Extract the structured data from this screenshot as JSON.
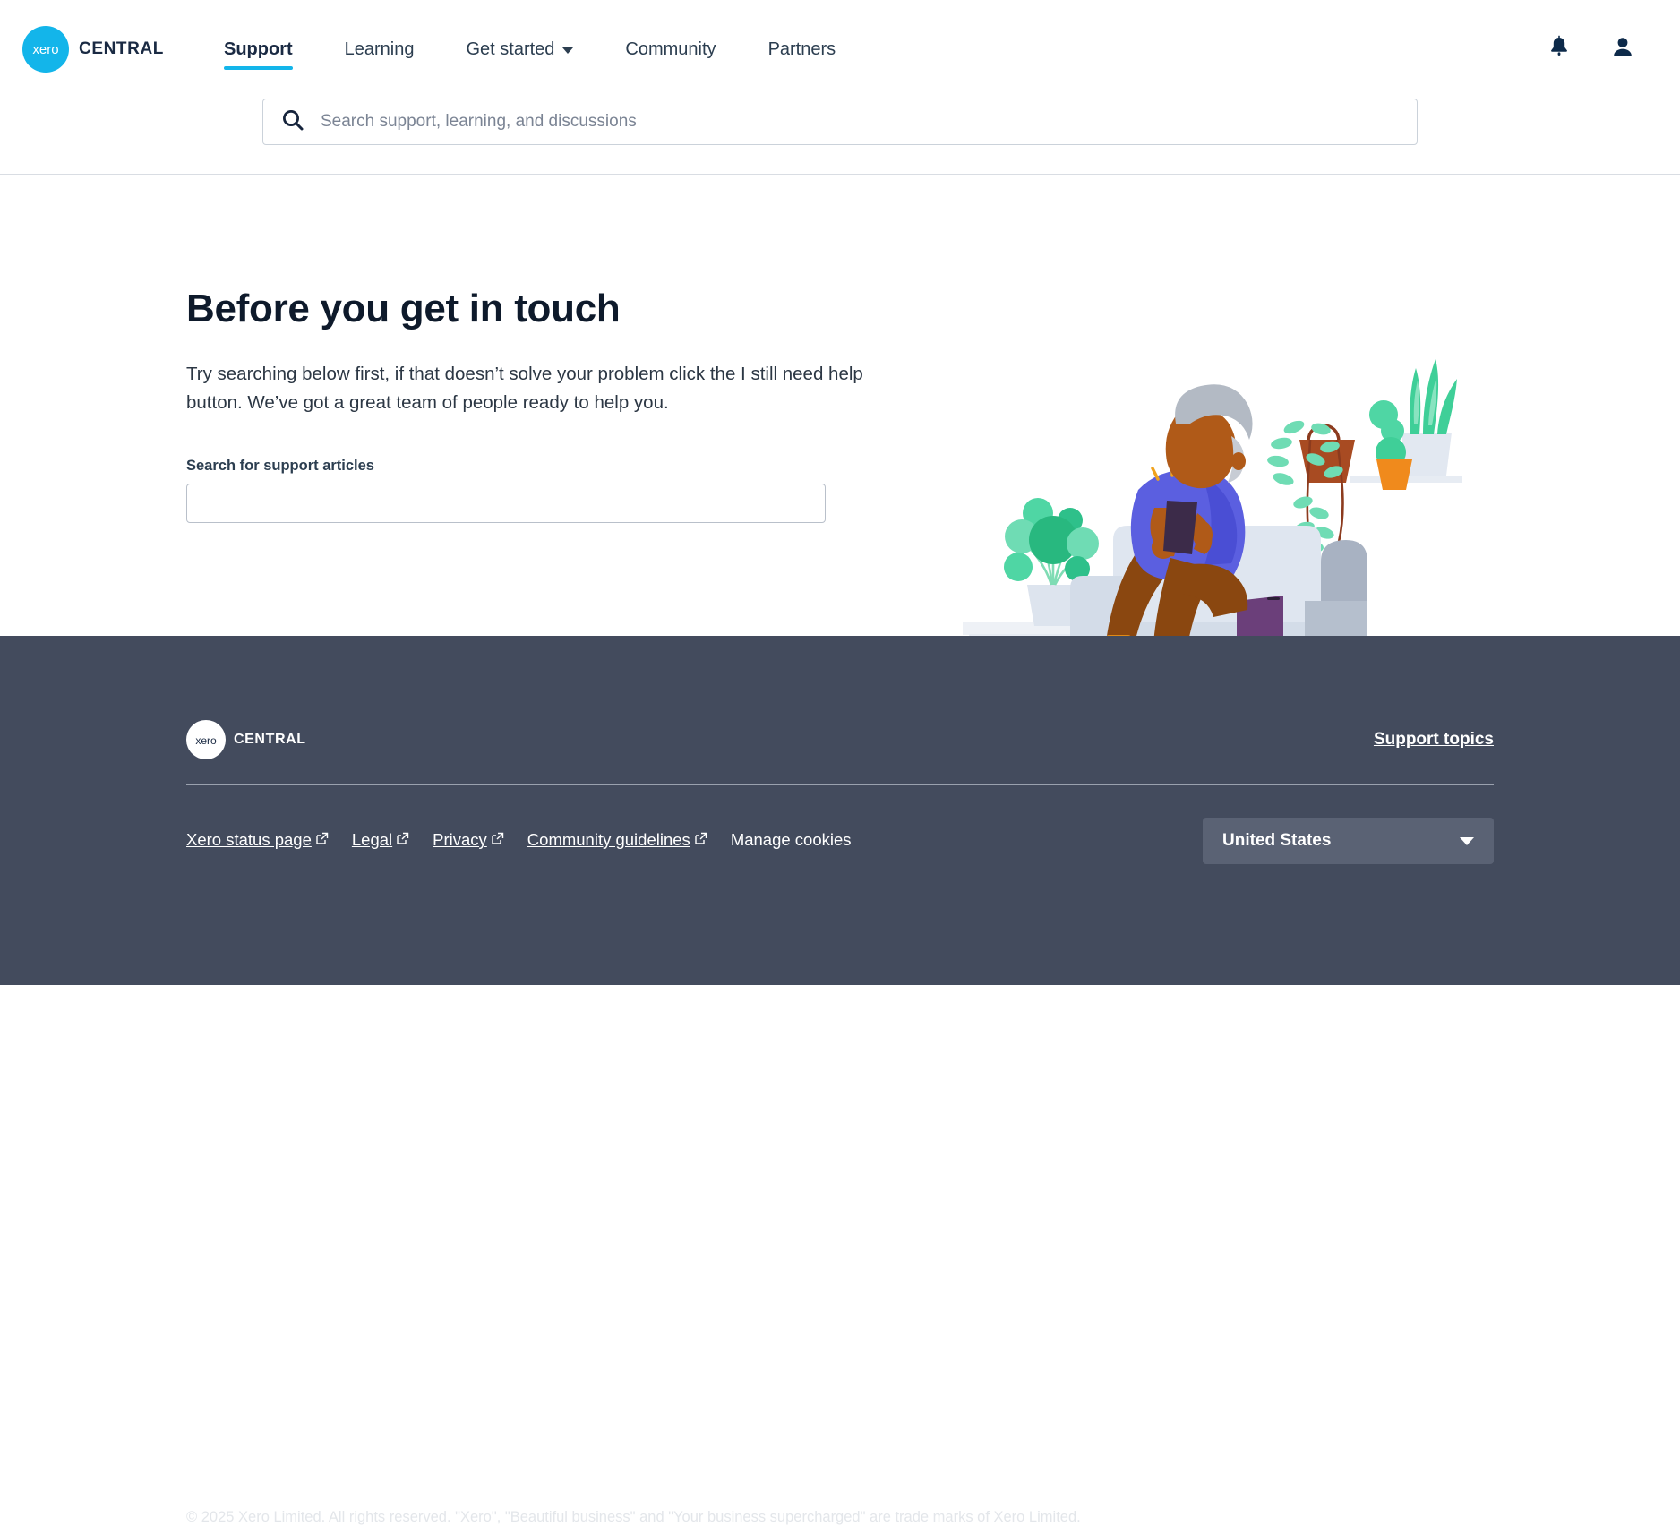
{
  "brand": {
    "mark_text": "xero",
    "word": "CENTRAL"
  },
  "nav": {
    "items": [
      {
        "label": "Support",
        "active": true,
        "has_chevron": false
      },
      {
        "label": "Learning",
        "active": false,
        "has_chevron": false
      },
      {
        "label": "Get started",
        "active": false,
        "has_chevron": true
      },
      {
        "label": "Community",
        "active": false,
        "has_chevron": false
      },
      {
        "label": "Partners",
        "active": false,
        "has_chevron": false
      }
    ],
    "icons": [
      {
        "name": "notifications-bell-icon"
      },
      {
        "name": "account-person-icon"
      }
    ]
  },
  "global_search": {
    "placeholder": "Search support, learning, and discussions",
    "value": "",
    "icon": "search-icon"
  },
  "hero": {
    "title": "Before you get in touch",
    "body": "Try searching below first, if that doesn’t solve your problem click the I still need help button. We’ve got a great team of people ready to help you.",
    "search_label": "Search for support articles",
    "search_value": "",
    "search_placeholder": "",
    "illustration_alt": "person sitting on sofa using a tablet with houseplants"
  },
  "footer": {
    "brand": {
      "mark_text": "xero",
      "word": "CENTRAL"
    },
    "support_topics_label": "Support topics",
    "links": [
      {
        "label": "Xero status page",
        "external": true,
        "underline": true
      },
      {
        "label": "Legal",
        "external": true,
        "underline": true
      },
      {
        "label": "Privacy",
        "external": true,
        "underline": true
      },
      {
        "label": "Community guidelines",
        "external": true,
        "underline": true
      },
      {
        "label": "Manage cookies",
        "external": false,
        "underline": false
      }
    ],
    "copyright": "© 2025 Xero Limited. All rights reserved. \"Xero\", \"Beautiful business\" and \"Your business supercharged\" are trade marks of Xero Limited.",
    "country_selected": "United States"
  },
  "colors": {
    "brand_blue": "#13b5ea",
    "ink": "#1a2a43",
    "footer_bg": "#434b5d",
    "country_bg": "#5a6274"
  }
}
